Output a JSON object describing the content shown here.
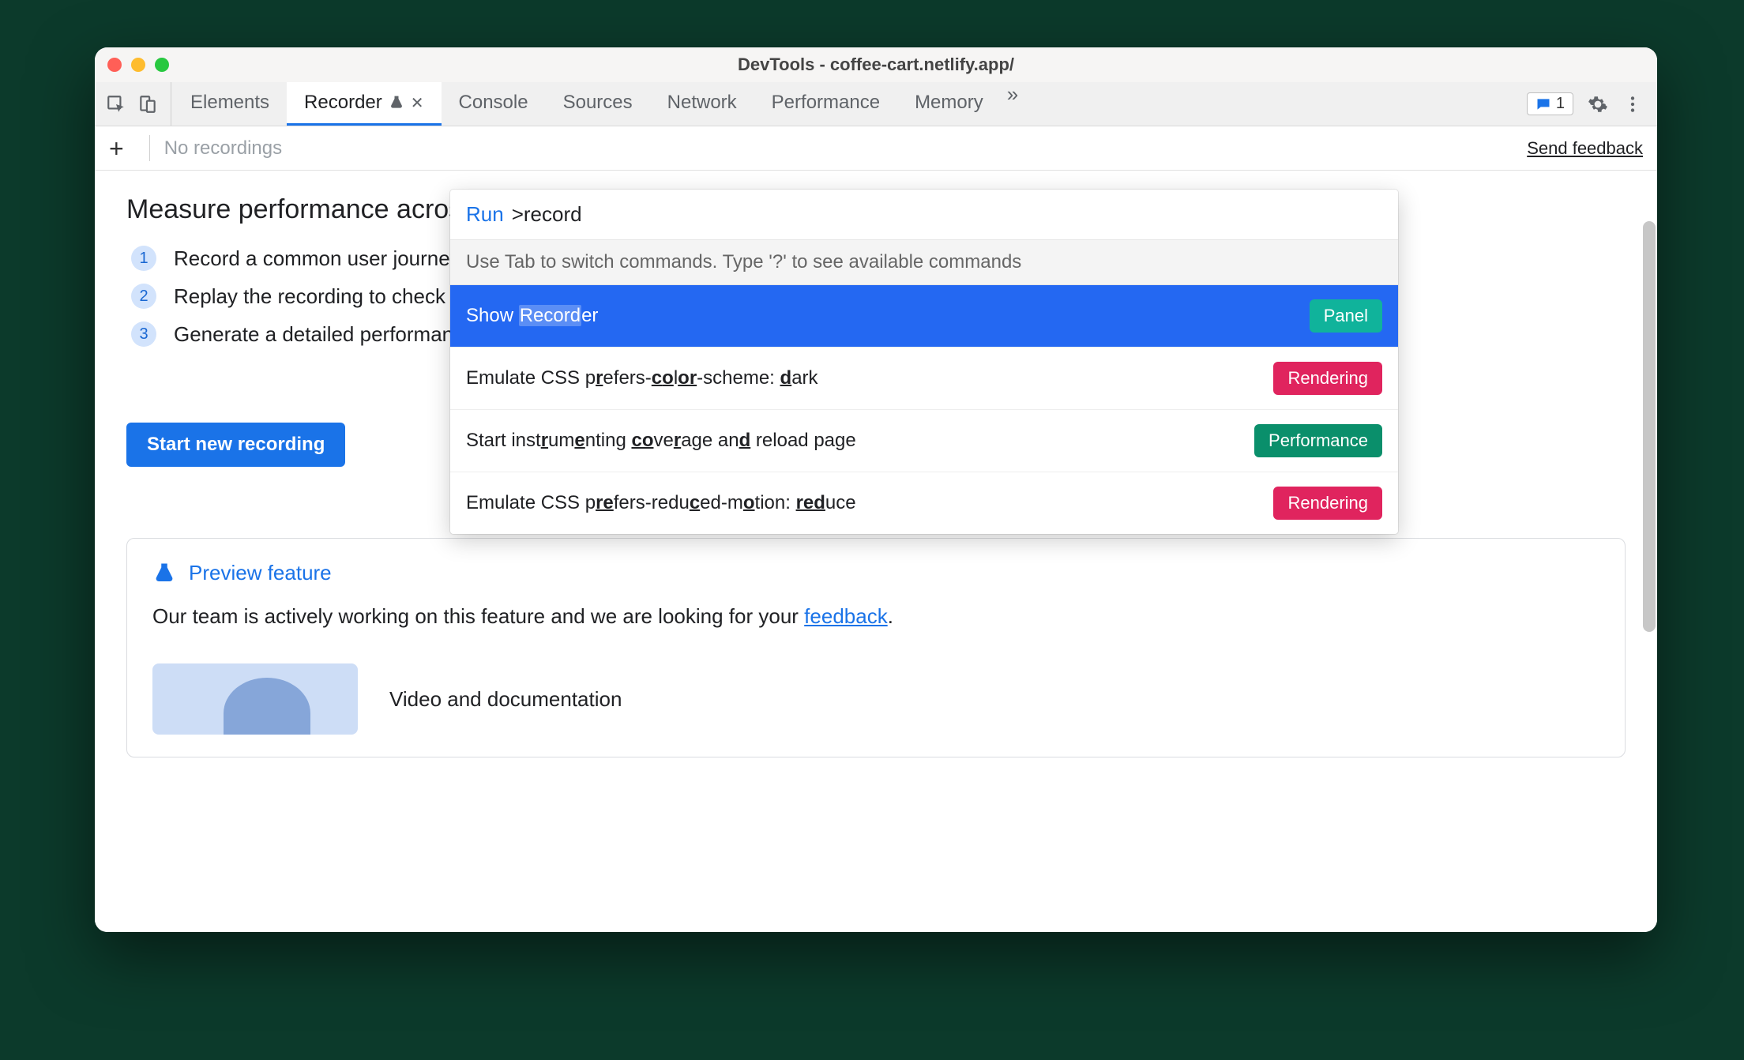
{
  "window": {
    "title": "DevTools - coffee-cart.netlify.app/"
  },
  "tabs": {
    "elements": "Elements",
    "recorder": "Recorder",
    "console": "Console",
    "sources": "Sources",
    "network": "Network",
    "performance": "Performance",
    "memory": "Memory"
  },
  "messages_count": "1",
  "subbar": {
    "no_recordings": "No recordings",
    "send_feedback": "Send feedback"
  },
  "page": {
    "heading": "Measure performance across an entire user journey",
    "steps": [
      "Record a common user journey",
      "Replay the recording to check it's working",
      "Generate a detailed performance trace"
    ],
    "start_button": "Start new recording"
  },
  "preview": {
    "title": "Preview feature",
    "body_before": "Our team is actively working on this feature and we are looking for your ",
    "body_link": "feedback",
    "body_after": ".",
    "media_title": "Video and documentation"
  },
  "palette": {
    "prefix": "Run",
    "query": ">record",
    "hint": "Use Tab to switch commands. Type '?' to see available commands",
    "rows": [
      {
        "before": "Show ",
        "match": "Record",
        "after": "er",
        "badge": "Panel",
        "badge_kind": "panel",
        "selected": true
      },
      {
        "before": "Emulate CSS p",
        "match": "r",
        "mid1": "efers-",
        "match2": "c",
        "mid2": "",
        "match3": "o",
        "mid3": "l",
        "match4": "or",
        "after": "-scheme: ",
        "match5": "d",
        "tail": "ark",
        "badge": "Rendering",
        "badge_kind": "rendering",
        "selected": false
      },
      {
        "before": "Start inst",
        "match": "r",
        "mid1": "um",
        "match2": "e",
        "mid2": "nting ",
        "match3": "co",
        "mid3": "ve",
        "match4": "r",
        "after": "age an",
        "match5": "d",
        "tail": " reload page",
        "badge": "Performance",
        "badge_kind": "performance",
        "selected": false
      },
      {
        "before": "Emulate CSS p",
        "match": "re",
        "mid1": "fers-redu",
        "match2": "c",
        "mid2": "ed-m",
        "match3": "o",
        "mid3": "tion: ",
        "match4": "red",
        "after": "u",
        "match5": "",
        "tail": "ce",
        "badge": "Rendering",
        "badge_kind": "rendering",
        "selected": false
      }
    ]
  }
}
